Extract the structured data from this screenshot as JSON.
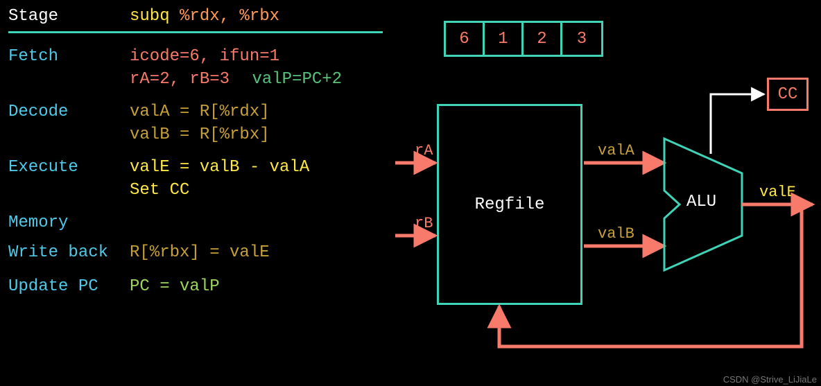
{
  "header": {
    "stage_label": "Stage",
    "instruction_pre": "subq ",
    "instruction_args": "%rdx, %rbx"
  },
  "stages": {
    "fetch": {
      "label": "Fetch",
      "line1": "icode=6, ifun=1",
      "line2a": "rA=2, rB=3",
      "line2b": "valP=PC+2"
    },
    "decode": {
      "label": "Decode",
      "line1": "valA = R[%rdx]",
      "line2": "valB = R[%rbx]"
    },
    "execute": {
      "label": "Execute",
      "line1": "valE = valB - valA",
      "line2": "Set CC"
    },
    "memory": {
      "label": "Memory"
    },
    "writeback": {
      "label": "Write back",
      "line1": "R[%rbx] = valE"
    },
    "updatepc": {
      "label": "Update PC",
      "line1": "PC = valP"
    }
  },
  "bytes": [
    "6",
    "1",
    "2",
    "3"
  ],
  "cc_label": "CC",
  "regfile_label": "Regfile",
  "alu_label": "ALU",
  "signals": {
    "rA": "rA",
    "rB": "rB",
    "valA": "valA",
    "valB": "valB",
    "valE": "valE"
  },
  "colors": {
    "teal_border": "#3fd4b8",
    "salmon": "#f77a6a",
    "white": "#ffffff",
    "yellow": "#ffe845",
    "orange": "#ff9a5b",
    "teal_text": "#4fc9e8",
    "green": "#57c27a",
    "gold": "#c8a038",
    "lime": "#9dd65a"
  },
  "watermark": "CSDN @Strive_LiJiaLe"
}
